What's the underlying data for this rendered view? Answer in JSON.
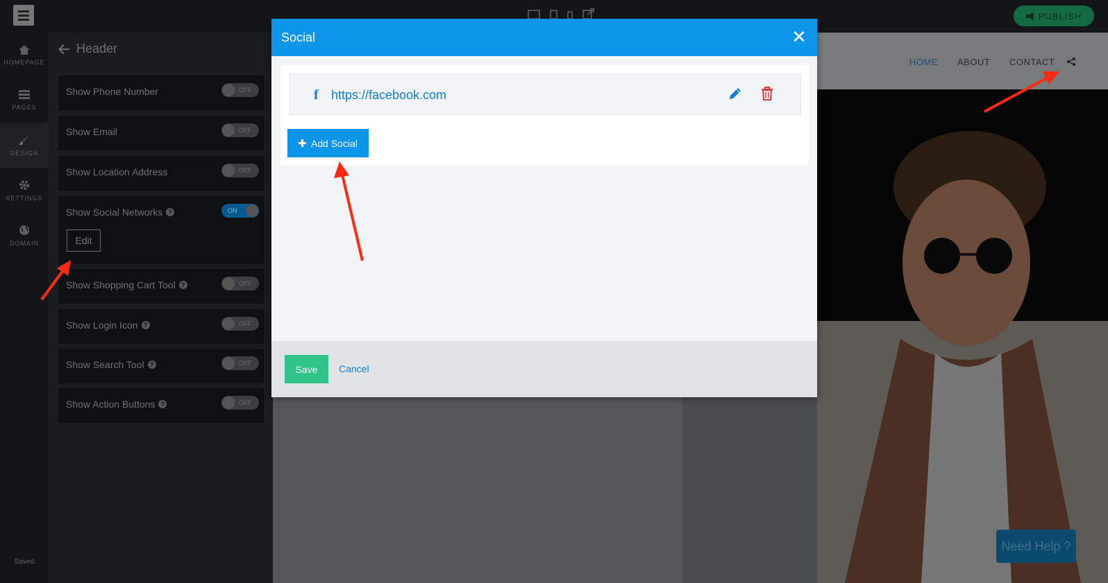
{
  "topbar": {
    "publish_label": "PUBLISH",
    "devices": [
      "desktop-icon",
      "tablet-icon",
      "mobile-icon",
      "external-link-icon"
    ]
  },
  "rail": {
    "items": [
      {
        "label": "HOMEPAGE",
        "icon": "home-icon"
      },
      {
        "label": "PAGES",
        "icon": "pages-icon"
      },
      {
        "label": "DESIGN",
        "icon": "brush-icon",
        "active": true
      },
      {
        "label": "SETTINGS",
        "icon": "gear-icon"
      },
      {
        "label": "DOMAIN",
        "icon": "globe-icon"
      }
    ],
    "status": "Saved"
  },
  "panel": {
    "title": "Header",
    "rows": [
      {
        "label": "Show Phone Number",
        "state": "OFF",
        "help": false
      },
      {
        "label": "Show Email",
        "state": "OFF",
        "help": false
      },
      {
        "label": "Show Location Address",
        "state": "OFF",
        "help": false
      },
      {
        "label": "Show Social Networks",
        "state": "ON",
        "help": true
      },
      {
        "label": "Show Shopping Cart Tool",
        "state": "OFF",
        "help": true
      },
      {
        "label": "Show Login Icon",
        "state": "OFF",
        "help": true
      },
      {
        "label": "Show Search Tool",
        "state": "OFF",
        "help": true
      },
      {
        "label": "Show Action Buttons",
        "state": "OFF",
        "help": true
      }
    ],
    "edit_label": "Edit"
  },
  "preview": {
    "nav": [
      "HOME",
      "ABOUT",
      "CONTACT"
    ],
    "share_icon": "share-icon",
    "help_label": "Need Help ?"
  },
  "modal": {
    "title": "Social",
    "social_items": [
      {
        "network": "facebook",
        "icon": "facebook-icon",
        "url": "https://facebook.com"
      }
    ],
    "add_label": "Add Social",
    "save_label": "Save",
    "cancel_label": "Cancel"
  },
  "colors": {
    "accent": "#0c95e9",
    "save": "#2fc389",
    "delete": "#e53935",
    "arrow": "#ff2a12"
  }
}
